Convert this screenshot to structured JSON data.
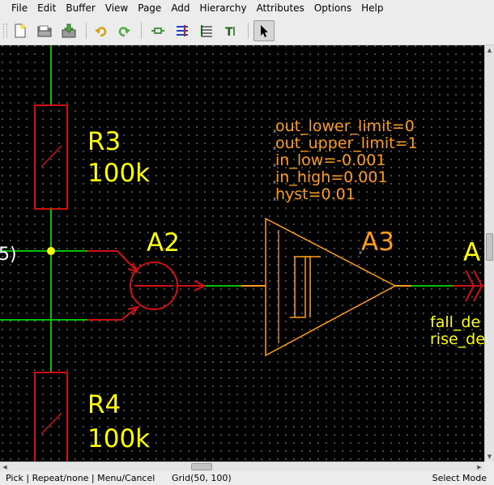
{
  "menu": [
    "File",
    "Edit",
    "Buffer",
    "View",
    "Page",
    "Add",
    "Hierarchy",
    "Attributes",
    "Options",
    "Help"
  ],
  "toolbar": {
    "buttons": [
      {
        "name": "new-file-icon"
      },
      {
        "name": "open-folder-icon"
      },
      {
        "name": "save-icon"
      },
      {
        "name": "undo-icon"
      },
      {
        "name": "redo-icon"
      },
      {
        "name": "add-component-icon"
      },
      {
        "name": "add-net-icon"
      },
      {
        "name": "add-bus-icon"
      },
      {
        "name": "add-text-icon"
      },
      {
        "name": "select-arrow-icon"
      }
    ]
  },
  "schematic": {
    "labels": {
      "r3_ref": "R3",
      "r3_value": "100k",
      "r4_ref": "R4",
      "r4_value": "100k",
      "a2_ref": "A2",
      "a3_ref": "A3",
      "a4_ref_partial": "A",
      "left_fragment": "5)",
      "fall_partial": "fall_de",
      "rise_partial": "rise_de"
    },
    "a3_params": [
      "out_lower_limit=0",
      "out_upper_limit=1",
      "in_low=-0.001",
      "in_high=0.001",
      "hyst=0.01"
    ],
    "colors": {
      "background": "#000000",
      "net": "#00c000",
      "component": "#d01010",
      "label": "#ffff00",
      "selected": "#ff9c1a",
      "junction": "#ffff00"
    }
  },
  "status": {
    "hint": "Pick | Repeat/none | Menu/Cancel",
    "grid": "Grid(50, 100)",
    "mode": "Select Mode"
  }
}
